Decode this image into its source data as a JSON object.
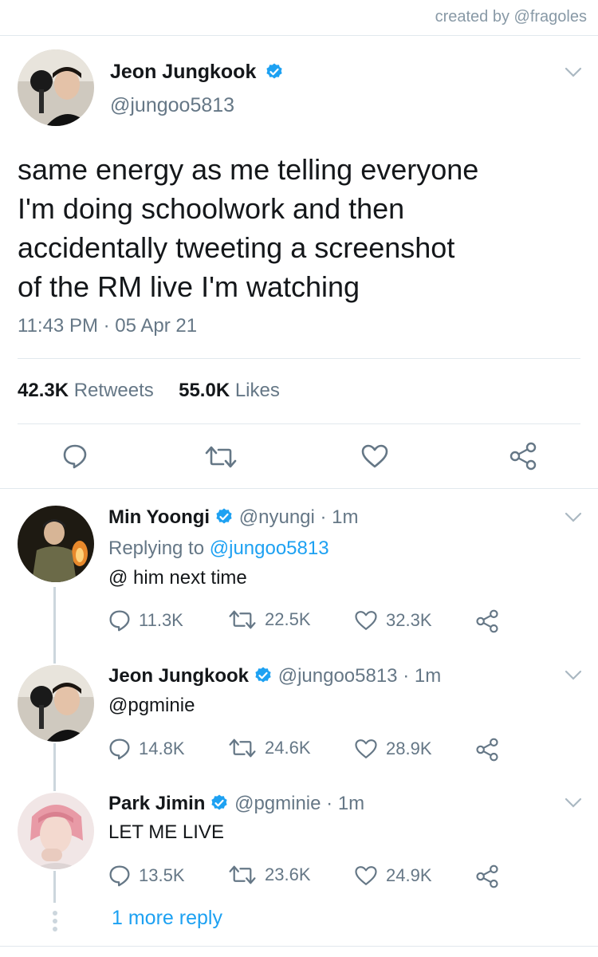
{
  "credit": "created by @fragoles",
  "main_tweet": {
    "name": "Jeon Jungkook",
    "handle": "@jungoo5813",
    "text_lines": [
      "same energy as me telling everyone",
      "I'm doing schoolwork and then",
      "accidentally tweeting a screenshot",
      "of the RM live I'm watching"
    ],
    "time": "11:43 PM",
    "sep": "·",
    "date": "05 Apr 21",
    "retweets_count": "42.3K",
    "retweets_label": "Retweets",
    "likes_count": "55.0K",
    "likes_label": "Likes"
  },
  "replies": [
    {
      "name": "Min Yoongi",
      "handle": "@nyungi · 1m",
      "replying_prefix": "Replying to ",
      "replying_to": "@jungoo5813",
      "body": "@ him next time",
      "replies": "11.3K",
      "retweets": "22.5K",
      "likes": "32.3K"
    },
    {
      "name": "Jeon Jungkook",
      "handle": "@jungoo5813 · 1m",
      "mention": "@pgminie",
      "replies": "14.8K",
      "retweets": "24.6K",
      "likes": "28.9K"
    },
    {
      "name": "Park Jimin",
      "handle": "@pgminie · 1m",
      "body": "LET ME LIVE",
      "replies": "13.5K",
      "retweets": "23.6K",
      "likes": "24.9K"
    }
  ],
  "more_replies": "1 more reply",
  "colors": {
    "accent": "#1da1f2",
    "muted": "#657786",
    "line": "#e1e8ed"
  },
  "icons": [
    "verified-icon",
    "chevron-down-icon",
    "reply-icon",
    "retweet-icon",
    "like-icon",
    "share-icon"
  ]
}
